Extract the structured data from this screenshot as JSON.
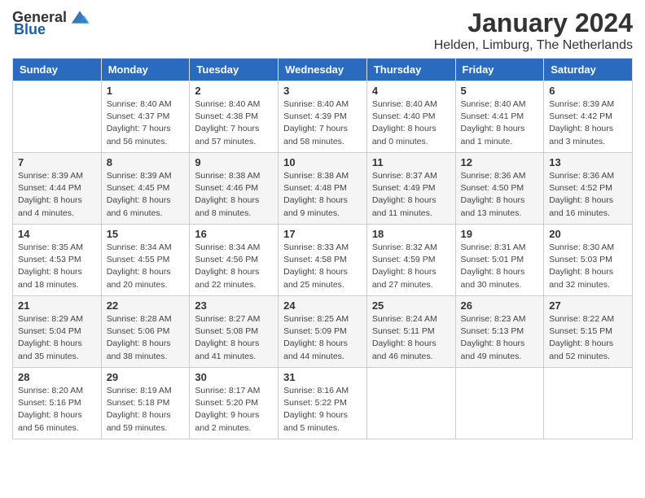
{
  "logo": {
    "text_general": "General",
    "text_blue": "Blue"
  },
  "title": "January 2024",
  "subtitle": "Helden, Limburg, The Netherlands",
  "weekdays": [
    "Sunday",
    "Monday",
    "Tuesday",
    "Wednesday",
    "Thursday",
    "Friday",
    "Saturday"
  ],
  "weeks": [
    [
      {
        "day": "",
        "sunrise": "",
        "sunset": "",
        "daylight": ""
      },
      {
        "day": "1",
        "sunrise": "Sunrise: 8:40 AM",
        "sunset": "Sunset: 4:37 PM",
        "daylight": "Daylight: 7 hours and 56 minutes."
      },
      {
        "day": "2",
        "sunrise": "Sunrise: 8:40 AM",
        "sunset": "Sunset: 4:38 PM",
        "daylight": "Daylight: 7 hours and 57 minutes."
      },
      {
        "day": "3",
        "sunrise": "Sunrise: 8:40 AM",
        "sunset": "Sunset: 4:39 PM",
        "daylight": "Daylight: 7 hours and 58 minutes."
      },
      {
        "day": "4",
        "sunrise": "Sunrise: 8:40 AM",
        "sunset": "Sunset: 4:40 PM",
        "daylight": "Daylight: 8 hours and 0 minutes."
      },
      {
        "day": "5",
        "sunrise": "Sunrise: 8:40 AM",
        "sunset": "Sunset: 4:41 PM",
        "daylight": "Daylight: 8 hours and 1 minute."
      },
      {
        "day": "6",
        "sunrise": "Sunrise: 8:39 AM",
        "sunset": "Sunset: 4:42 PM",
        "daylight": "Daylight: 8 hours and 3 minutes."
      }
    ],
    [
      {
        "day": "7",
        "sunrise": "Sunrise: 8:39 AM",
        "sunset": "Sunset: 4:44 PM",
        "daylight": "Daylight: 8 hours and 4 minutes."
      },
      {
        "day": "8",
        "sunrise": "Sunrise: 8:39 AM",
        "sunset": "Sunset: 4:45 PM",
        "daylight": "Daylight: 8 hours and 6 minutes."
      },
      {
        "day": "9",
        "sunrise": "Sunrise: 8:38 AM",
        "sunset": "Sunset: 4:46 PM",
        "daylight": "Daylight: 8 hours and 8 minutes."
      },
      {
        "day": "10",
        "sunrise": "Sunrise: 8:38 AM",
        "sunset": "Sunset: 4:48 PM",
        "daylight": "Daylight: 8 hours and 9 minutes."
      },
      {
        "day": "11",
        "sunrise": "Sunrise: 8:37 AM",
        "sunset": "Sunset: 4:49 PM",
        "daylight": "Daylight: 8 hours and 11 minutes."
      },
      {
        "day": "12",
        "sunrise": "Sunrise: 8:36 AM",
        "sunset": "Sunset: 4:50 PM",
        "daylight": "Daylight: 8 hours and 13 minutes."
      },
      {
        "day": "13",
        "sunrise": "Sunrise: 8:36 AM",
        "sunset": "Sunset: 4:52 PM",
        "daylight": "Daylight: 8 hours and 16 minutes."
      }
    ],
    [
      {
        "day": "14",
        "sunrise": "Sunrise: 8:35 AM",
        "sunset": "Sunset: 4:53 PM",
        "daylight": "Daylight: 8 hours and 18 minutes."
      },
      {
        "day": "15",
        "sunrise": "Sunrise: 8:34 AM",
        "sunset": "Sunset: 4:55 PM",
        "daylight": "Daylight: 8 hours and 20 minutes."
      },
      {
        "day": "16",
        "sunrise": "Sunrise: 8:34 AM",
        "sunset": "Sunset: 4:56 PM",
        "daylight": "Daylight: 8 hours and 22 minutes."
      },
      {
        "day": "17",
        "sunrise": "Sunrise: 8:33 AM",
        "sunset": "Sunset: 4:58 PM",
        "daylight": "Daylight: 8 hours and 25 minutes."
      },
      {
        "day": "18",
        "sunrise": "Sunrise: 8:32 AM",
        "sunset": "Sunset: 4:59 PM",
        "daylight": "Daylight: 8 hours and 27 minutes."
      },
      {
        "day": "19",
        "sunrise": "Sunrise: 8:31 AM",
        "sunset": "Sunset: 5:01 PM",
        "daylight": "Daylight: 8 hours and 30 minutes."
      },
      {
        "day": "20",
        "sunrise": "Sunrise: 8:30 AM",
        "sunset": "Sunset: 5:03 PM",
        "daylight": "Daylight: 8 hours and 32 minutes."
      }
    ],
    [
      {
        "day": "21",
        "sunrise": "Sunrise: 8:29 AM",
        "sunset": "Sunset: 5:04 PM",
        "daylight": "Daylight: 8 hours and 35 minutes."
      },
      {
        "day": "22",
        "sunrise": "Sunrise: 8:28 AM",
        "sunset": "Sunset: 5:06 PM",
        "daylight": "Daylight: 8 hours and 38 minutes."
      },
      {
        "day": "23",
        "sunrise": "Sunrise: 8:27 AM",
        "sunset": "Sunset: 5:08 PM",
        "daylight": "Daylight: 8 hours and 41 minutes."
      },
      {
        "day": "24",
        "sunrise": "Sunrise: 8:25 AM",
        "sunset": "Sunset: 5:09 PM",
        "daylight": "Daylight: 8 hours and 44 minutes."
      },
      {
        "day": "25",
        "sunrise": "Sunrise: 8:24 AM",
        "sunset": "Sunset: 5:11 PM",
        "daylight": "Daylight: 8 hours and 46 minutes."
      },
      {
        "day": "26",
        "sunrise": "Sunrise: 8:23 AM",
        "sunset": "Sunset: 5:13 PM",
        "daylight": "Daylight: 8 hours and 49 minutes."
      },
      {
        "day": "27",
        "sunrise": "Sunrise: 8:22 AM",
        "sunset": "Sunset: 5:15 PM",
        "daylight": "Daylight: 8 hours and 52 minutes."
      }
    ],
    [
      {
        "day": "28",
        "sunrise": "Sunrise: 8:20 AM",
        "sunset": "Sunset: 5:16 PM",
        "daylight": "Daylight: 8 hours and 56 minutes."
      },
      {
        "day": "29",
        "sunrise": "Sunrise: 8:19 AM",
        "sunset": "Sunset: 5:18 PM",
        "daylight": "Daylight: 8 hours and 59 minutes."
      },
      {
        "day": "30",
        "sunrise": "Sunrise: 8:17 AM",
        "sunset": "Sunset: 5:20 PM",
        "daylight": "Daylight: 9 hours and 2 minutes."
      },
      {
        "day": "31",
        "sunrise": "Sunrise: 8:16 AM",
        "sunset": "Sunset: 5:22 PM",
        "daylight": "Daylight: 9 hours and 5 minutes."
      },
      {
        "day": "",
        "sunrise": "",
        "sunset": "",
        "daylight": ""
      },
      {
        "day": "",
        "sunrise": "",
        "sunset": "",
        "daylight": ""
      },
      {
        "day": "",
        "sunrise": "",
        "sunset": "",
        "daylight": ""
      }
    ]
  ]
}
